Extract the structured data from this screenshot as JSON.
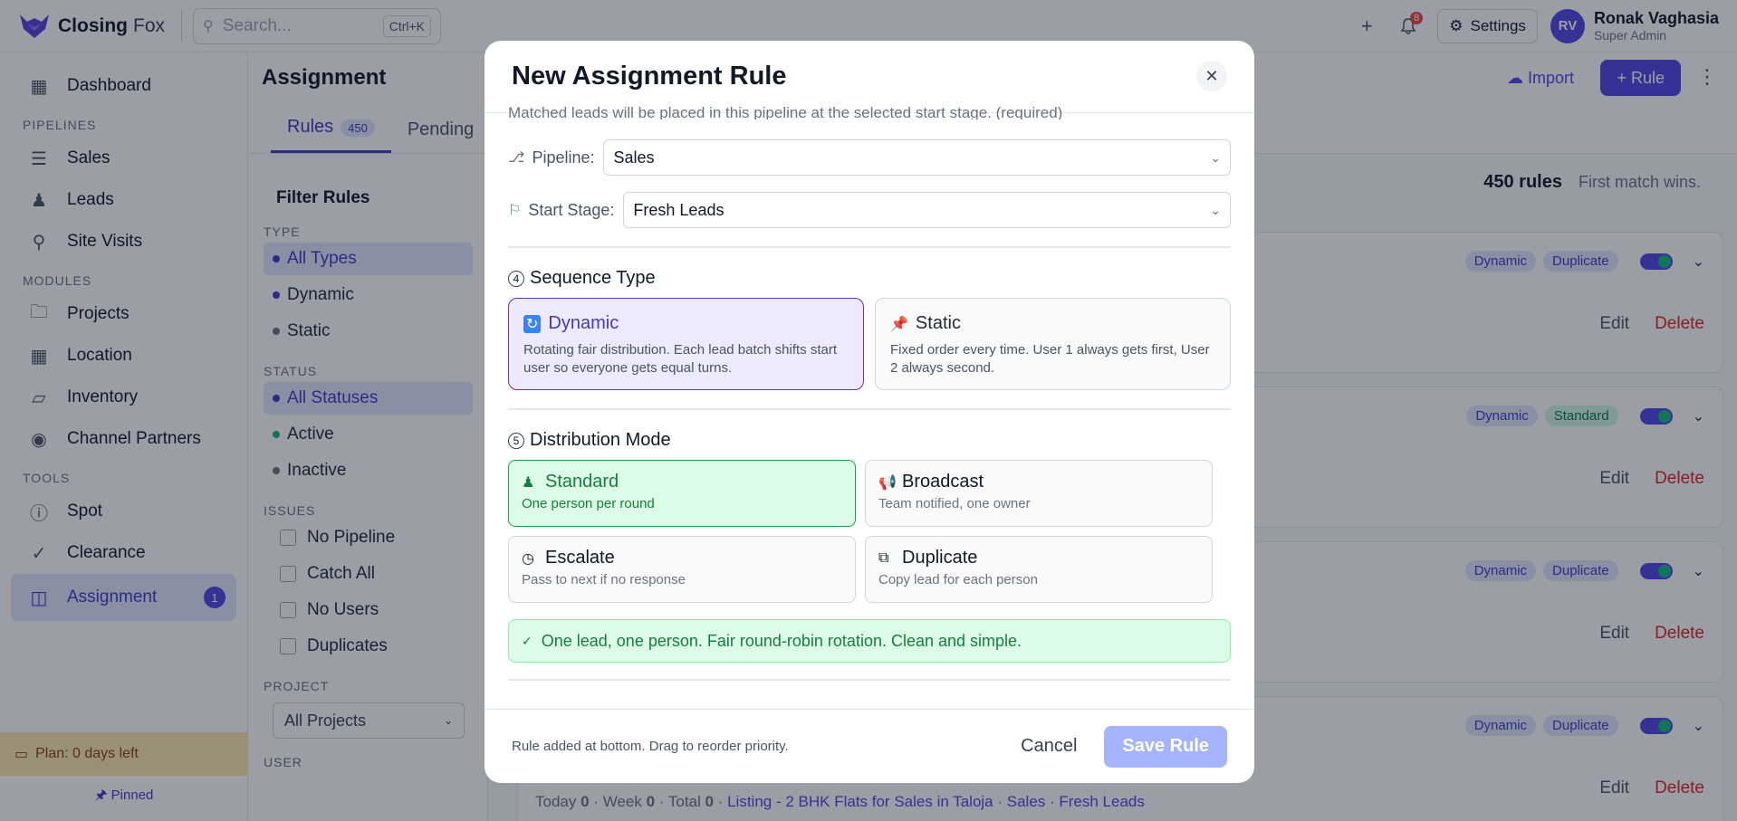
{
  "app": {
    "logo_primary": "Closing",
    "logo_secondary": "Fox"
  },
  "search": {
    "placeholder": "Search...",
    "shortcut": "Ctrl+K"
  },
  "topbar": {
    "notif_count": "8",
    "settings_label": "Settings"
  },
  "user": {
    "initials": "RV",
    "name": "Ronak Vaghasia",
    "role": "Super Admin"
  },
  "sidebar": {
    "dashboard": "Dashboard",
    "section_pipelines": "PIPELINES",
    "sales": "Sales",
    "leads": "Leads",
    "site_visits": "Site Visits",
    "section_modules": "MODULES",
    "projects": "Projects",
    "location": "Location",
    "inventory": "Inventory",
    "channel_partners": "Channel Partners",
    "section_tools": "TOOLS",
    "spot": "Spot",
    "clearance": "Clearance",
    "assignment": "Assignment",
    "assignment_count": "1",
    "plan": "Plan: 0 days left",
    "pinned": "Pinned"
  },
  "main": {
    "title": "Assignment",
    "import_label": "Import",
    "rule_btn": "+ Rule",
    "tab_rules": "Rules",
    "tab_rules_count": "450",
    "tab_pending": "Pending",
    "rules_total": "450 rules",
    "rules_hint": "First match wins.",
    "edit_label": "Edit",
    "delete_label": "Delete",
    "tag_dynamic": "Dynamic",
    "tag_duplicate": "Duplicate",
    "tag_standard": "Standard",
    "bottom_today": "Today",
    "bottom_today_val": "0",
    "bottom_week": "Week",
    "bottom_week_val": "0",
    "bottom_total": "Total",
    "bottom_total_val": "0",
    "bottom_listing": "Listing - 2 BHK Flats for Sales in Taloja",
    "bottom_pipeline": "Sales · Fresh Leads"
  },
  "filter": {
    "title": "Filter Rules",
    "sec_type": "TYPE",
    "all_types": "All Types",
    "dynamic": "Dynamic",
    "static": "Static",
    "sec_status": "STATUS",
    "all_statuses": "All Statuses",
    "active": "Active",
    "inactive": "Inactive",
    "sec_issues": "ISSUES",
    "no_pipeline": "No Pipeline",
    "catch_all": "Catch All",
    "no_users": "No Users",
    "duplicates": "Duplicates",
    "sec_project": "PROJECT",
    "project_value": "All Projects",
    "sec_user": "USER"
  },
  "modal": {
    "title": "New Assignment Rule",
    "clipped_text": "Matched leads will be placed in this pipeline at the selected start stage. (required)",
    "pipeline_label": "Pipeline:",
    "pipeline_value": "Sales",
    "stage_label": "Start Stage:",
    "stage_value": "Fresh Leads",
    "seq_num": "4",
    "seq_title": "Sequence Type",
    "seq_dynamic_title": "Dynamic",
    "seq_dynamic_desc": "Rotating fair distribution. Each lead batch shifts start user so everyone gets equal turns.",
    "seq_static_title": "Static",
    "seq_static_desc": "Fixed order every time. User 1 always gets first, User 2 always second.",
    "dist_num": "5",
    "dist_title": "Distribution Mode",
    "mode_standard_title": "Standard",
    "mode_standard_desc": "One person per round",
    "mode_broadcast_title": "Broadcast",
    "mode_broadcast_desc": "Team notified, one owner",
    "mode_escalate_title": "Escalate",
    "mode_escalate_desc": "Pass to next if no response",
    "mode_duplicate_title": "Duplicate",
    "mode_duplicate_desc": "Copy lead for each person",
    "info_text": "One lead, one person. Fair round-robin rotation. Clean and simple.",
    "foot_note": "Rule added at bottom. Drag to reorder priority.",
    "cancel_label": "Cancel",
    "save_label": "Save Rule"
  }
}
